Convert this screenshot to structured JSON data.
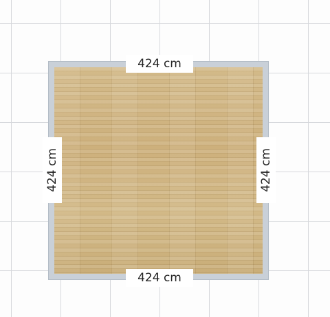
{
  "room": {
    "dimensions": {
      "top": "424 cm",
      "bottom": "424 cm",
      "left": "424 cm",
      "right": "424 cm"
    },
    "colors": {
      "background": "#fdfdfd",
      "grid": "#d6d8dc",
      "wall": "#c9d0d8",
      "floor": "#cdb27f"
    }
  }
}
